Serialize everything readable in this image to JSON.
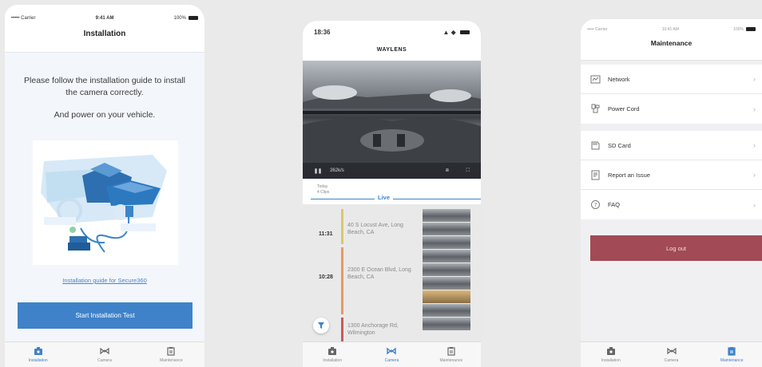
{
  "screen1": {
    "status": {
      "carrier": "••••• Carrier",
      "time": "9:41 AM",
      "battery": "100%"
    },
    "title": "Installation",
    "instruction": "Please follow the installation guide to install the camera correctly.",
    "instruction2": "And power on your vehicle.",
    "guide_link": "Installation guide for Secure360",
    "start_button": "Start Installation Test",
    "tabs": [
      {
        "label": "Installation",
        "icon": "camera-box-icon"
      },
      {
        "label": "Camera",
        "icon": "link-icon"
      },
      {
        "label": "Maintenance",
        "icon": "clipboard-icon"
      }
    ],
    "active_tab": 0
  },
  "screen2": {
    "status": {
      "time": "18:36"
    },
    "title": "WAYLENS",
    "bitrate": "262k/s",
    "today": "Today",
    "clips_count": "4 Clips",
    "live_label": "Live",
    "clips": [
      {
        "time": "11:31",
        "location": "40 S Locust Ave, Long Beach, CA",
        "color": "#d8c96a"
      },
      {
        "time": "10:28",
        "location": "2300 E Ocean Blvd, Long Beach, CA",
        "color": "#e39a62"
      },
      {
        "time": "",
        "location": "1300 Anchorage Rd, Wilmington",
        "color": "#c95a5a"
      }
    ],
    "tabs": [
      {
        "label": "Installation",
        "icon": "camera-box-icon"
      },
      {
        "label": "Camera",
        "icon": "link-icon"
      },
      {
        "label": "Maintenance",
        "icon": "clipboard-icon"
      }
    ],
    "active_tab": 1
  },
  "screen3": {
    "status": {
      "carrier": "••••• Carrier",
      "time": "10:41 AM",
      "battery": "100%"
    },
    "title": "Maintenance",
    "group1": [
      {
        "label": "Network",
        "icon": "network-icon"
      },
      {
        "label": "Power Cord",
        "icon": "power-cord-icon"
      }
    ],
    "group2": [
      {
        "label": "SD Card",
        "icon": "sd-card-icon"
      },
      {
        "label": "Report an Issue",
        "icon": "report-icon"
      },
      {
        "label": "FAQ",
        "icon": "question-icon"
      }
    ],
    "chevron": "›",
    "logout": "Log out",
    "tabs": [
      {
        "label": "Installation",
        "icon": "camera-box-icon"
      },
      {
        "label": "Camera",
        "icon": "link-icon"
      },
      {
        "label": "Maintenance",
        "icon": "clipboard-icon"
      }
    ],
    "active_tab": 2
  },
  "colors": {
    "accent": "#3f82c9",
    "logout": "#a24a55"
  }
}
